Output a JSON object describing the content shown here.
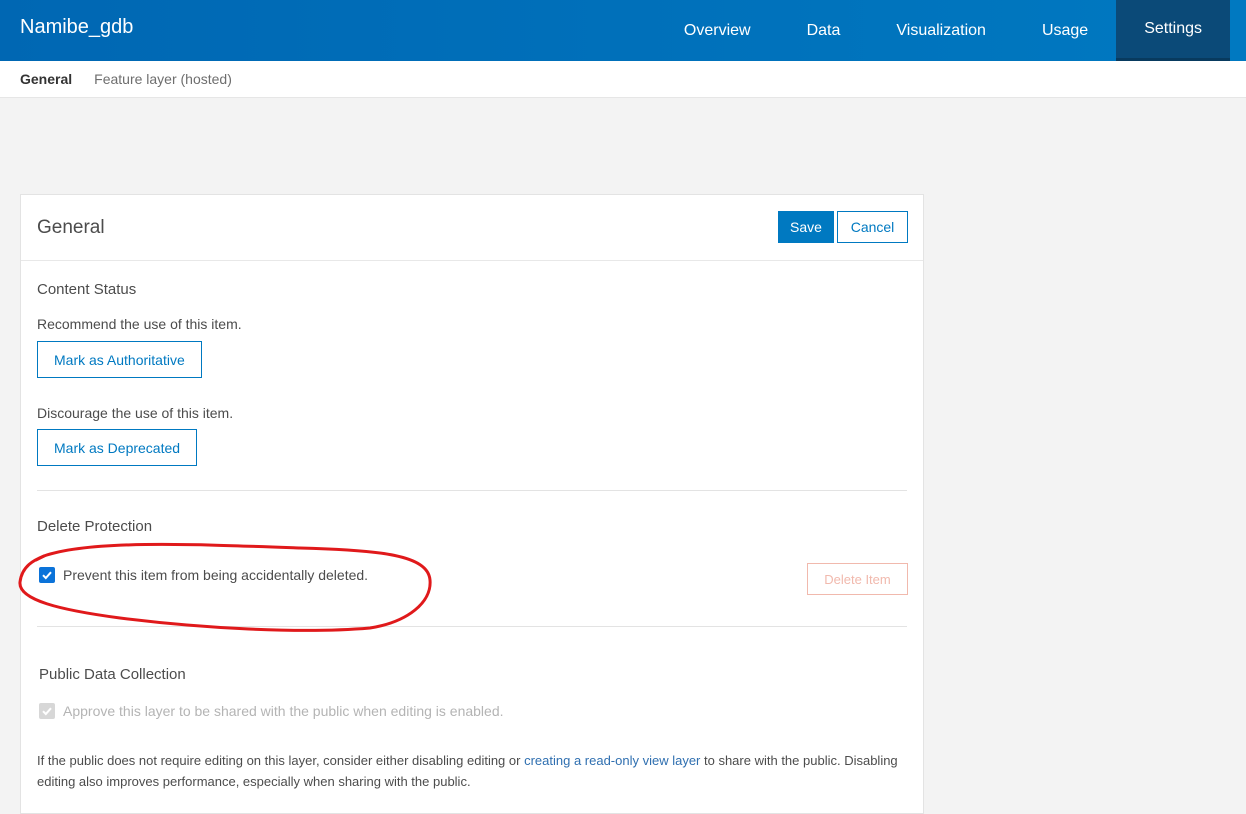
{
  "header": {
    "title": "Namibe_gdb",
    "nav": [
      {
        "label": "Overview",
        "active": false
      },
      {
        "label": "Data",
        "active": false
      },
      {
        "label": "Visualization",
        "active": false
      },
      {
        "label": "Usage",
        "active": false
      },
      {
        "label": "Settings",
        "active": true
      }
    ]
  },
  "subnav": {
    "items": [
      {
        "label": "General",
        "active": true
      },
      {
        "label": "Feature layer (hosted)",
        "active": false
      }
    ]
  },
  "general": {
    "title": "General",
    "save_label": "Save",
    "cancel_label": "Cancel"
  },
  "content_status": {
    "title": "Content Status",
    "recommend_text": "Recommend the use of this item.",
    "authoritative_label": "Mark as Authoritative",
    "discourage_text": "Discourage the use of this item.",
    "deprecated_label": "Mark as Deprecated"
  },
  "delete_protection": {
    "title": "Delete Protection",
    "checkbox_label": "Prevent this item from being accidentally deleted.",
    "checked": true,
    "delete_label": "Delete Item"
  },
  "public_data": {
    "title": "Public Data Collection",
    "checkbox_label": "Approve this layer to be shared with the public when editing is enabled.",
    "checked": true,
    "note_before": "If the public does not require editing on this layer, consider either disabling editing or ",
    "note_link": "creating a read-only view layer",
    "note_after": " to share with the public. Disabling editing also improves performance, especially when sharing with the public."
  },
  "colors": {
    "brand": "#0079c1",
    "annotation": "#e0191b"
  }
}
